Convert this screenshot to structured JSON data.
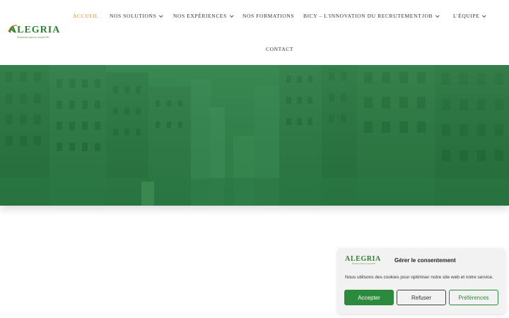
{
  "brand": {
    "logo_word": "ALEGRIA",
    "logo_tagline": "Performer dans le conseil RH",
    "primary_color": "#2e7d32",
    "accent_color": "#e08a1e"
  },
  "nav": {
    "items": [
      {
        "label": "ACCUEIL",
        "active": true,
        "has_dropdown": false
      },
      {
        "label": "NOS SOLUTIONS",
        "active": false,
        "has_dropdown": true
      },
      {
        "label": "NOS EXPÉRIENCES",
        "active": false,
        "has_dropdown": true
      },
      {
        "label": "NOS FORMATIONS",
        "active": false,
        "has_dropdown": false
      },
      {
        "label": "BICY – L'INNOVATION DU RECRUTEMENT",
        "active": false,
        "has_dropdown": false
      },
      {
        "label": "JOB",
        "active": false,
        "has_dropdown": true
      },
      {
        "label": "L'ÉQUIPE",
        "active": false,
        "has_dropdown": true
      },
      {
        "label": "CONTACT",
        "active": false,
        "has_dropdown": false
      }
    ]
  },
  "hero": {
    "overlay_color": "#2e7c46",
    "image": "city-street-buildings"
  },
  "cookie_banner": {
    "title": "Gérer le consentement",
    "message": "Nous utilisons des cookies pour optimiser notre site web et notre service.",
    "accept_label": "Accepter",
    "refuse_label": "Refuser",
    "preferences_label": "Préférences"
  }
}
